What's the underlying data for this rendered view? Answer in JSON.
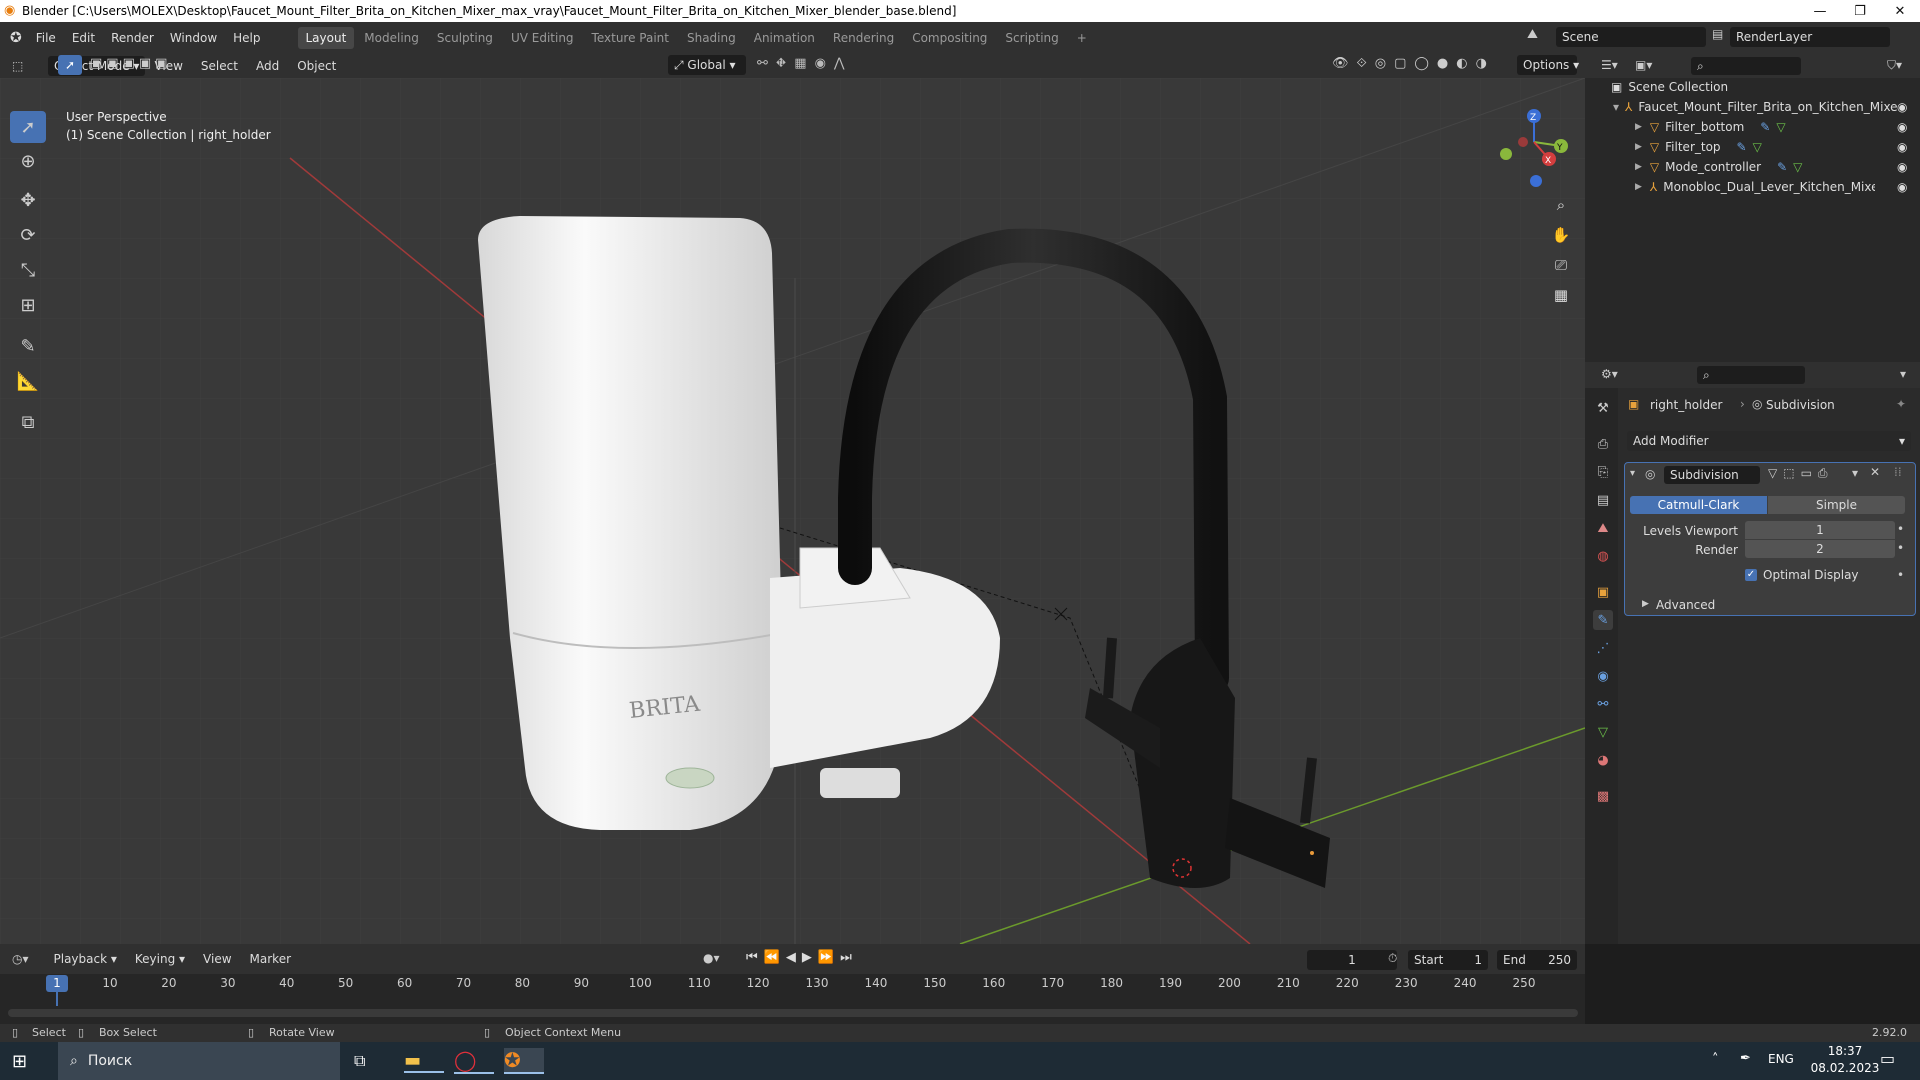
{
  "window": {
    "title": "Blender [C:\\Users\\MOLEX\\Desktop\\Faucet_Mount_Filter_Brita_on_Kitchen_Mixer_max_vray\\Faucet_Mount_Filter_Brita_on_Kitchen_Mixer_blender_base.blend]",
    "minimize": "—",
    "restore": "❐",
    "close": "✕"
  },
  "menu": [
    "File",
    "Edit",
    "Render",
    "Window",
    "Help"
  ],
  "workspaces": [
    "Layout",
    "Modeling",
    "Sculpting",
    "UV Editing",
    "Texture Paint",
    "Shading",
    "Animation",
    "Rendering",
    "Compositing",
    "Scripting",
    "+"
  ],
  "scene": {
    "name": "Scene",
    "view_layer": "RenderLayer"
  },
  "viewport_header": {
    "mode": "Object Mode",
    "items": [
      "View",
      "Select",
      "Add",
      "Object"
    ],
    "orientation": "Global",
    "options": "Options"
  },
  "viewport": {
    "perspective": "User Perspective",
    "collection_info": "(1) Scene Collection | right_holder",
    "gizmo_axes": [
      "Z",
      "Y",
      "X"
    ]
  },
  "outliner": {
    "root": "Scene Collection",
    "collection": "Faucet_Mount_Filter_Brita_on_Kitchen_Mixe",
    "objects": [
      "Filter_bottom",
      "Filter_top",
      "Mode_controller",
      "Monobloc_Dual_Lever_Kitchen_Mixer_Ta"
    ]
  },
  "properties": {
    "object": "right_holder",
    "modifier_crumb": "Subdivision",
    "add_modifier": "Add Modifier",
    "modifier_name": "Subdivision",
    "type_options": [
      "Catmull-Clark",
      "Simple"
    ],
    "fields": [
      {
        "label": "Levels Viewport",
        "value": "1"
      },
      {
        "label": "Render",
        "value": "2"
      }
    ],
    "optimal_display": "Optimal Display",
    "advanced": "Advanced"
  },
  "timeline": {
    "menus": [
      "Playback",
      "Keying",
      "View",
      "Marker"
    ],
    "current_frame": "1",
    "start_label": "Start",
    "start": "1",
    "end_label": "End",
    "end": "250",
    "ticks": [
      "1",
      "10",
      "20",
      "30",
      "40",
      "50",
      "60",
      "70",
      "80",
      "90",
      "100",
      "110",
      "120",
      "130",
      "140",
      "150",
      "160",
      "170",
      "180",
      "190",
      "200",
      "210",
      "220",
      "230",
      "240",
      "250"
    ]
  },
  "status": {
    "select": "Select",
    "box_select": "Box Select",
    "rotate_view": "Rotate View",
    "context_menu": "Object Context Menu",
    "version": "2.92.0"
  },
  "taskbar": {
    "search": "Поиск",
    "lang": "ENG",
    "time": "18:37",
    "date": "08.02.2023"
  },
  "model": {
    "brand": "BRITA"
  }
}
